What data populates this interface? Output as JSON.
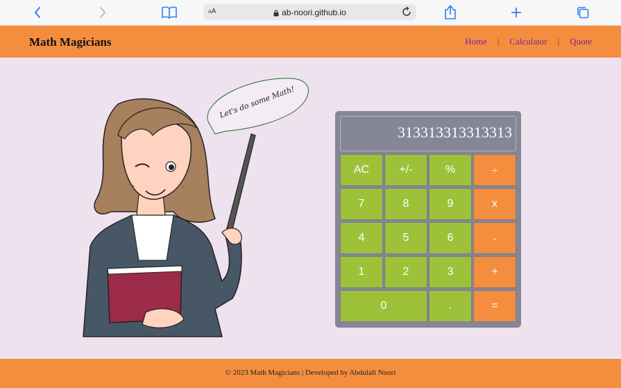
{
  "browser": {
    "url": "ab-noori.github.io",
    "text_size_label": "AA"
  },
  "header": {
    "brand": "Math Magicians",
    "nav": [
      {
        "label": "Home"
      },
      {
        "label": "Calculator"
      },
      {
        "label": "Quote"
      }
    ],
    "separator": "|"
  },
  "illustration": {
    "speech": "Let's do some Math!"
  },
  "calculator": {
    "display": "313313313313313",
    "keys": {
      "ac": "AC",
      "sign": "+/-",
      "percent": "%",
      "divide": "÷",
      "seven": "7",
      "eight": "8",
      "nine": "9",
      "multiply": "x",
      "four": "4",
      "five": "5",
      "six": "6",
      "minus": "-",
      "one": "1",
      "two": "2",
      "three": "3",
      "plus": "+",
      "zero": "0",
      "dot": ".",
      "equals": "="
    }
  },
  "footer": {
    "text": "© 2023 Math Magicians | Developed by Abdulali Noori"
  },
  "colors": {
    "header_bg": "#f48e3e",
    "page_bg": "#efe2ef",
    "key_green": "#9dc23a",
    "key_orange": "#f48e3e",
    "calc_body": "#858696",
    "nav_link": "#7a1fa2"
  }
}
